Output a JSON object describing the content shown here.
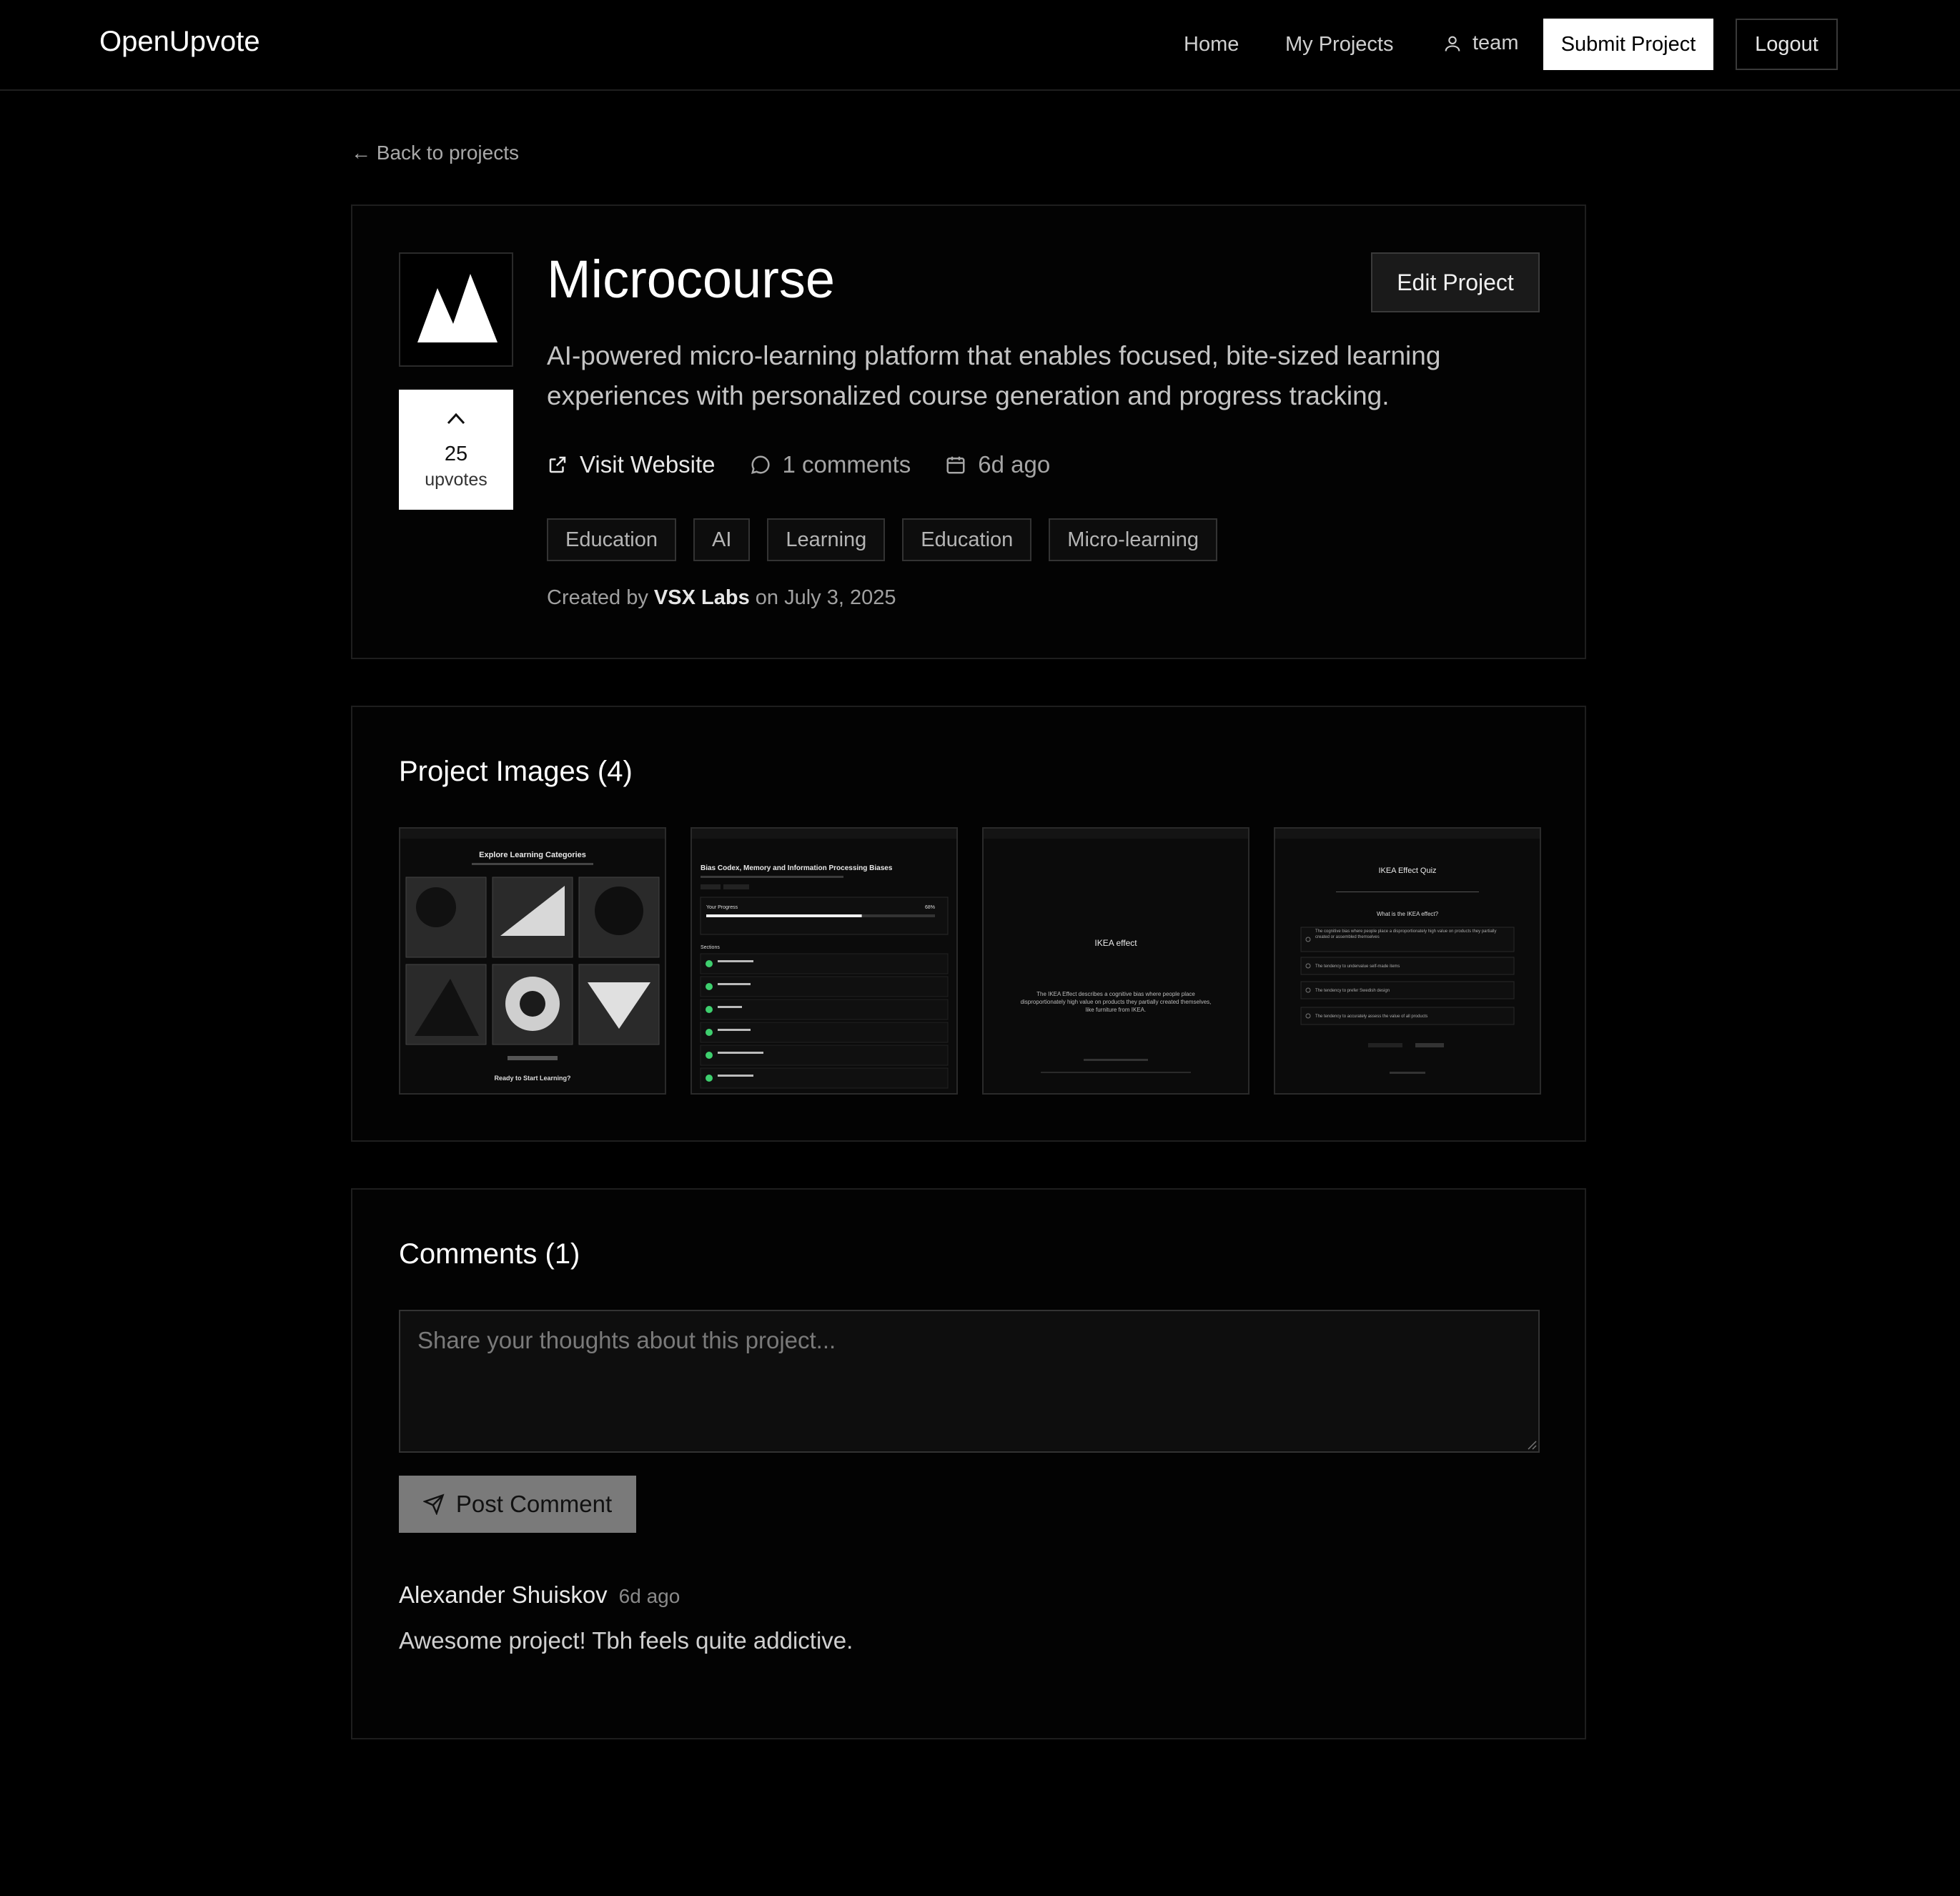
{
  "header": {
    "brand": "OpenUpvote",
    "nav": {
      "home": "Home",
      "my_projects": "My Projects",
      "user": "team",
      "submit": "Submit Project",
      "logout": "Logout"
    }
  },
  "back_link": "← Back to projects",
  "project": {
    "title": "Microcourse",
    "edit_label": "Edit Project",
    "description": "AI-powered micro-learning platform that enables focused, bite-sized learning experiences with personalized course generation and progress tracking.",
    "upvotes": "25",
    "upvotes_label": "upvotes",
    "visit_label": "Visit Website",
    "comments_count": "1 comments",
    "age": "6d ago",
    "tags": [
      "Education",
      "AI",
      "Learning",
      "Education",
      "Micro-learning"
    ],
    "created_prefix": "Created by",
    "creator": "VSX Labs",
    "created_suffix": "on July 3, 2025"
  },
  "images": {
    "title": "Project Images (4)",
    "thumbs": [
      {
        "heading": "Explore Learning Categories",
        "footer": "Ready to Start Learning?"
      },
      {
        "heading": "Bias Codex, Memory and Information Processing Biases",
        "progress_label": "Your Progress",
        "progress": 0.68,
        "progress_text": "68%",
        "sections_label": "Sections"
      },
      {
        "heading": "IKEA effect",
        "body": "The IKEA Effect describes a cognitive bias where people place disproportionately high value on products they partially created themselves, like furniture from IKEA."
      },
      {
        "heading": "IKEA Effect Quiz",
        "question": "What is the IKEA effect?",
        "options": [
          "The cognitive bias where people place a disproportionately high value on products they partially created or assembled themselves",
          "The tendency to undervalue self-made items",
          "The tendency to prefer Swedish design",
          "The tendency to accurately assess the value of all products"
        ]
      }
    ]
  },
  "comments": {
    "title": "Comments (1)",
    "placeholder": "Share your thoughts about this project...",
    "post_label": "Post Comment",
    "items": [
      {
        "author": "Alexander Shuiskov",
        "time": "6d ago",
        "body": "Awesome project! Tbh feels quite addictive."
      }
    ]
  },
  "colors": {
    "background": "#000000",
    "card_border": "#1e1e1e",
    "primary_button": "#ffffff",
    "post_button": "#7a7a7a",
    "progress_green": "#3ecf6e"
  },
  "icons": [
    "user-icon",
    "external-link-icon",
    "comment-icon",
    "calendar-icon",
    "chevron-up-icon",
    "send-icon",
    "arrow-left-icon"
  ]
}
